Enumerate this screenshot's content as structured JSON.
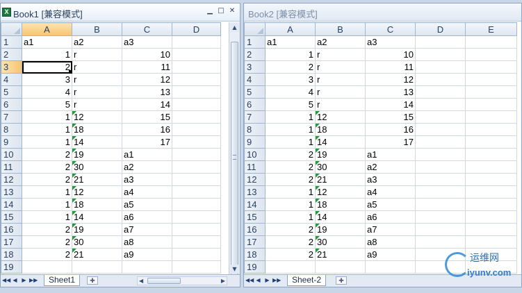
{
  "window1": {
    "title": "Book1  [兼容模式]",
    "app_icon_glyph": "X",
    "controls": [
      "▁",
      "□",
      "✕"
    ],
    "columns": [
      "A",
      "B",
      "C",
      "D"
    ],
    "selected_column": "A",
    "selected_row": 3,
    "active_cell": "A3",
    "visible_rows": 19,
    "sheet_tab": "Sheet1",
    "new_sheet_icon": "insert-sheet-icon"
  },
  "window2": {
    "title": "Book2  [兼容模式]",
    "columns": [
      "A",
      "B",
      "C",
      "D",
      "E"
    ],
    "visible_rows": 19,
    "sheet_tab": "Sheet-2",
    "new_sheet_icon": "insert-sheet-icon"
  },
  "cells": [
    [
      "a1",
      "a2",
      "a3"
    ],
    [
      "1",
      "r",
      "10"
    ],
    [
      "2",
      "r",
      "11"
    ],
    [
      "3",
      "r",
      "12"
    ],
    [
      "4",
      "r",
      "13"
    ],
    [
      "5",
      "r",
      "14"
    ],
    [
      "1",
      "12",
      "15"
    ],
    [
      "1",
      "18",
      "16"
    ],
    [
      "1",
      "14",
      "17"
    ],
    [
      "2",
      "19",
      "a1"
    ],
    [
      "2",
      "30",
      "a2"
    ],
    [
      "2",
      "21",
      "a3"
    ],
    [
      "1",
      "12",
      "a4"
    ],
    [
      "1",
      "18",
      "a5"
    ],
    [
      "1",
      "14",
      "a6"
    ],
    [
      "2",
      "19",
      "a7"
    ],
    [
      "2",
      "30",
      "a8"
    ],
    [
      "2",
      "21",
      "a9"
    ]
  ],
  "tab_nav": [
    "◀◀",
    "◀",
    "▶",
    "▶▶"
  ],
  "watermark": {
    "cn": "运维网",
    "url": "iyunv.com"
  }
}
